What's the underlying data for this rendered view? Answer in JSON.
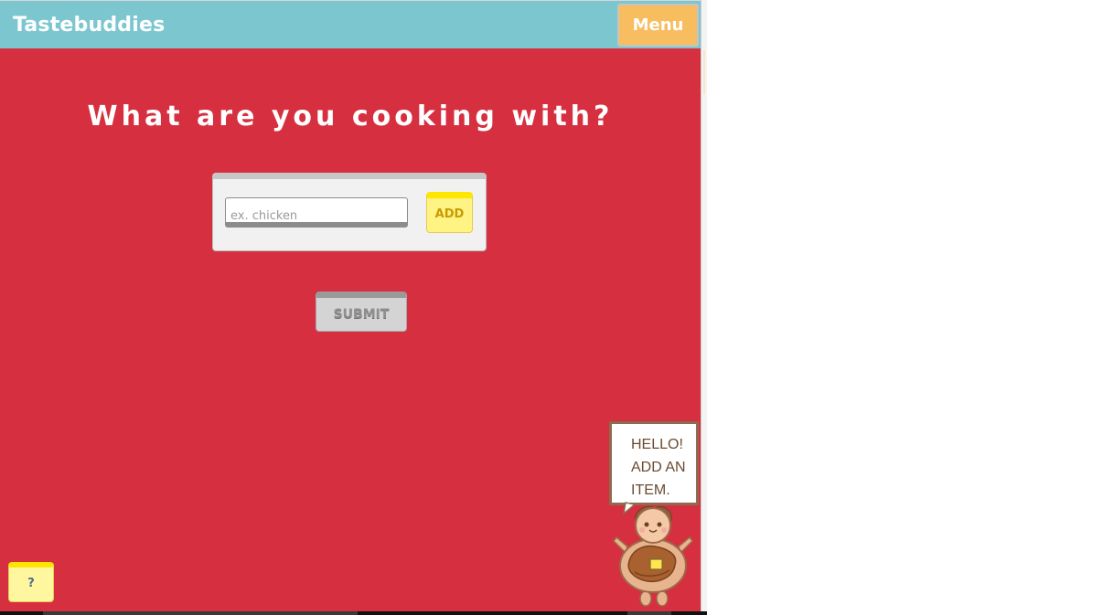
{
  "header": {
    "brand": "Tastebuddies",
    "menu_label": "Menu"
  },
  "main": {
    "heading": "What are you cooking with?",
    "ingredient_input": {
      "value": "",
      "placeholder": "ex. chicken"
    },
    "add_label": "ADD",
    "submit_label": "SUBMIT"
  },
  "help": {
    "label": "?"
  },
  "mascot": {
    "speech_lines": [
      "HELLO!",
      "ADD AN",
      "ITEM."
    ],
    "icon": "pancake-mascot-icon"
  },
  "colors": {
    "page_background": "#d62f40",
    "header_background": "#7cc6cf",
    "menu_button": "#f7bd5f",
    "add_button": "#fff384",
    "submit_button": "#d4d4d4",
    "help_button": "#fff79f"
  }
}
